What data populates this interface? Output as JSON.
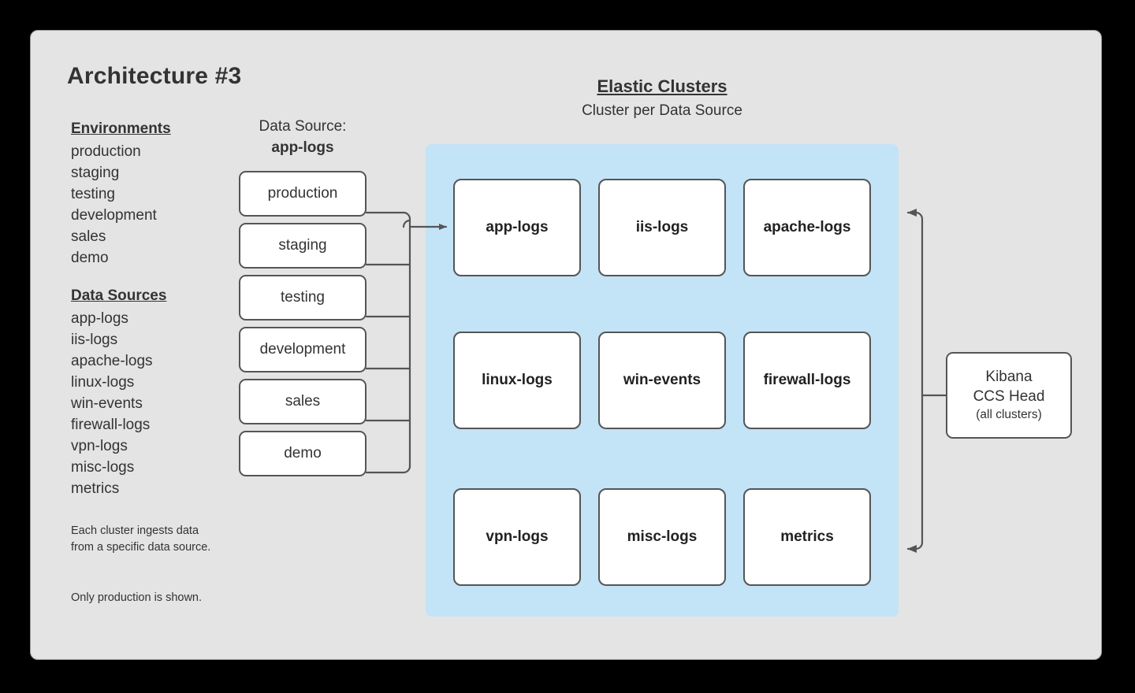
{
  "page": {
    "title": "Architecture #3",
    "background_color": "#000000",
    "frame_color": "#e4e4e4",
    "cluster_panel_color": "#c3e3f7",
    "box_border_color": "#555555",
    "text_color": "#333333"
  },
  "legend": {
    "environments": {
      "heading": "Environments",
      "items": [
        "production",
        "staging",
        "testing",
        "development",
        "sales",
        "demo"
      ]
    },
    "data_sources": {
      "heading": "Data Sources",
      "items": [
        "app-logs",
        "iis-logs",
        "apache-logs",
        "linux-logs",
        "win-events",
        "firewall-logs",
        "vpn-logs",
        "misc-logs",
        "metrics"
      ]
    },
    "notes": [
      "Each cluster ingests data from a specific data source.",
      "Only production is shown."
    ]
  },
  "data_source_column": {
    "label": "Data Source:",
    "value": "app-logs",
    "boxes": [
      "production",
      "staging",
      "testing",
      "development",
      "sales",
      "demo"
    ]
  },
  "clusters": {
    "title": "Elastic Clusters",
    "subtitle": "Cluster per Data Source",
    "grid": [
      [
        "app-logs",
        "iis-logs",
        "apache-logs"
      ],
      [
        "linux-logs",
        "win-events",
        "firewall-logs"
      ],
      [
        "vpn-logs",
        "misc-logs",
        "metrics"
      ]
    ]
  },
  "kibana": {
    "line1": "Kibana",
    "line2": "CCS Head",
    "line3": "(all clusters)"
  }
}
